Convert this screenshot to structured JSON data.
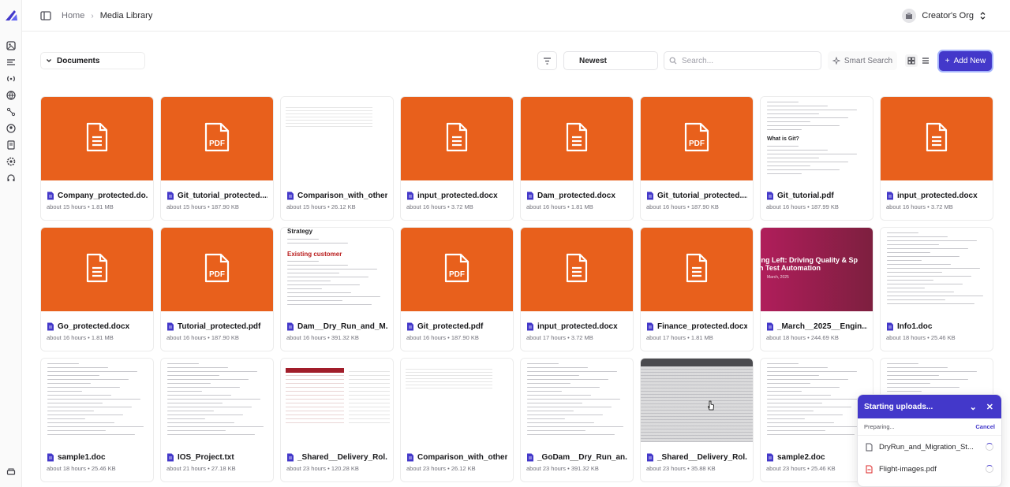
{
  "breadcrumb": {
    "home": "Home",
    "separator": "›",
    "current": "Media Library"
  },
  "org": {
    "name": "Creator's Org"
  },
  "toolbar": {
    "collection": "Documents",
    "sort": "Newest",
    "search_placeholder": "Search...",
    "smart_search": "Smart Search",
    "add_new": "Add New"
  },
  "colors": {
    "accent": "#4338ca",
    "file_tile": "#e8601c"
  },
  "files": [
    {
      "name": "Company_protected.do...",
      "meta": "about 15 hours • 1.81 MB",
      "thumb": "orange",
      "icon": "doc-icon"
    },
    {
      "name": "Git_tutorial_protected....",
      "meta": "about 15 hours • 187.90 KB",
      "thumb": "orange",
      "icon": "pdf-icon"
    },
    {
      "name": "Comparison_with_other...",
      "meta": "about 15 hours • 26.12 KB",
      "thumb": "table",
      "icon": "doc-icon"
    },
    {
      "name": "input_protected.docx",
      "meta": "about 16 hours • 3.72 MB",
      "thumb": "orange",
      "icon": "doc-icon"
    },
    {
      "name": "Dam_protected.docx",
      "meta": "about 16 hours • 1.81 MB",
      "thumb": "orange",
      "icon": "doc-icon"
    },
    {
      "name": "Git_tutorial_protected....",
      "meta": "about 16 hours • 187.90 KB",
      "thumb": "orange",
      "icon": "pdf-icon"
    },
    {
      "name": "Git_tutorial.pdf",
      "meta": "about 16 hours • 187.99 KB",
      "thumb": "git",
      "icon": "doc-icon"
    },
    {
      "name": "input_protected.docx",
      "meta": "about 16 hours • 3.72 MB",
      "thumb": "orange",
      "icon": "doc-icon"
    },
    {
      "name": "Go_protected.docx",
      "meta": "about 16 hours • 1.81 MB",
      "thumb": "orange",
      "icon": "doc-icon"
    },
    {
      "name": "Tutorial_protected.pdf",
      "meta": "about 16 hours • 187.90 KB",
      "thumb": "orange",
      "icon": "pdf-icon"
    },
    {
      "name": "Dam__Dry_Run_and_M...",
      "meta": "about 16 hours • 391.32 KB",
      "thumb": "strategy",
      "icon": "doc-icon"
    },
    {
      "name": "Git_protected.pdf",
      "meta": "about 16 hours • 187.90 KB",
      "thumb": "orange",
      "icon": "pdf-icon"
    },
    {
      "name": "input_protected.docx",
      "meta": "about 17 hours • 3.72 MB",
      "thumb": "orange",
      "icon": "doc-icon"
    },
    {
      "name": "Finance_protected.docx",
      "meta": "about 17 hours • 1.81 MB",
      "thumb": "orange",
      "icon": "doc-icon"
    },
    {
      "name": "_March__2025__Engin...",
      "meta": "about 18 hours • 244.69 KB",
      "thumb": "slide",
      "icon": "doc-icon"
    },
    {
      "name": "Info1.doc",
      "meta": "about 18 hours • 25.46 KB",
      "thumb": "text",
      "icon": "doc-icon"
    },
    {
      "name": "sample1.doc",
      "meta": "about 18 hours • 25.46 KB",
      "thumb": "text",
      "icon": "doc-icon"
    },
    {
      "name": "IOS_Project.txt",
      "meta": "about 21 hours • 27.18 KB",
      "thumb": "text",
      "icon": "doc-icon"
    },
    {
      "name": "_Shared__Delivery_Rol...",
      "meta": "about 23 hours • 120.28 KB",
      "thumb": "redtable",
      "icon": "doc-icon"
    },
    {
      "name": "Comparison_with_other...",
      "meta": "about 23 hours • 26.12 KB",
      "thumb": "table",
      "icon": "doc-icon"
    },
    {
      "name": "_GoDam__Dry_Run_an...",
      "meta": "about 23 hours • 391.32 KB",
      "thumb": "text",
      "icon": "doc-icon"
    },
    {
      "name": "_Shared__Delivery_Rol...",
      "meta": "about 23 hours • 35.88 KB",
      "thumb": "dark",
      "icon": "doc-icon"
    },
    {
      "name": "sample2.doc",
      "meta": "about 23 hours • 25.46 KB",
      "thumb": "text",
      "icon": "doc-icon"
    },
    {
      "name": "",
      "meta": "",
      "thumb": "text",
      "icon": "doc-icon"
    }
  ],
  "thumb_text": {
    "git_heading": "What is Git?",
    "strategy_title": "Strategy",
    "strategy_heading": "Existing customer",
    "slide_title_1": "fting Left: Driving Quality & Sp",
    "slide_title_2": "h Test Automation",
    "slide_sub": "March, 2025",
    "pdf_label": "PDF"
  },
  "uploads": {
    "title": "Starting uploads...",
    "status": "Preparing...",
    "cancel": "Cancel",
    "items": [
      {
        "name": "DryRun_and_Migration_St...",
        "icon": "doc-icon"
      },
      {
        "name": "Flight-images.pdf",
        "icon": "pdf-icon"
      }
    ]
  },
  "sidebar_icons": [
    "media-icon",
    "list-icon",
    "broadcast-icon",
    "globe-icon",
    "share-icon",
    "user-icon",
    "book-icon",
    "settings-icon",
    "headset-icon"
  ]
}
